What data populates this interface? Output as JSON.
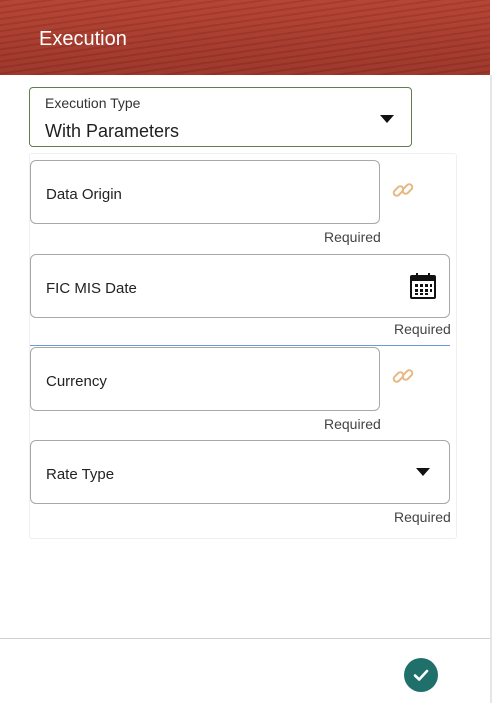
{
  "header": {
    "title": "Execution"
  },
  "execution_type": {
    "label": "Execution Type",
    "value": "With Parameters"
  },
  "fields": {
    "data_origin": {
      "label": "Data Origin",
      "required": "Required",
      "icon": "link-icon"
    },
    "fic_mis_date": {
      "label": "FIC MIS Date",
      "required": "Required",
      "icon": "calendar-icon"
    },
    "currency": {
      "label": "Currency",
      "required": "Required",
      "icon": "link-icon"
    },
    "rate_type": {
      "label": "Rate Type",
      "required": "Required",
      "icon": "chevron-down-icon"
    }
  },
  "footer": {
    "ok_icon": "check-icon"
  },
  "colors": {
    "header": "#a63a2b",
    "exec_border": "#5f7d4f",
    "link_icon": "#e8b883",
    "ok_button": "#1f6f6a",
    "divider": "#6a9bd8"
  }
}
